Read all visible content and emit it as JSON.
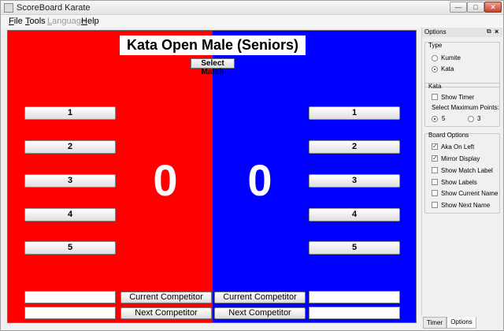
{
  "window": {
    "title": "ScoreBoard Karate"
  },
  "menu": [
    {
      "label": "File",
      "mnemonic": "F",
      "rest": "ile",
      "enabled": true
    },
    {
      "label": "Tools",
      "mnemonic": "T",
      "rest": "ools",
      "enabled": true
    },
    {
      "label": "Language",
      "mnemonic": "L",
      "rest": "anguage",
      "enabled": false
    },
    {
      "label": "Help",
      "mnemonic": "H",
      "rest": "elp",
      "enabled": true
    }
  ],
  "board": {
    "match_label": "Kata Open Male (Seniors)",
    "select_match": "Select Match",
    "aka_color": "#ff0000",
    "ao_color": "#0000ff",
    "aka_buttons": [
      "1",
      "2",
      "3",
      "4",
      "5"
    ],
    "ao_buttons": [
      "1",
      "2",
      "3",
      "4",
      "5"
    ],
    "aka_score": "0",
    "ao_score": "0",
    "aka_current_label": "Current Competitor",
    "aka_next_label": "Next Competitor",
    "ao_current_label": "Current Competitor",
    "ao_next_label": "Next Competitor",
    "aka_current_value": "",
    "aka_next_value": "",
    "ao_current_value": "",
    "ao_next_value": ""
  },
  "options": {
    "title": "Options",
    "type_group": "Type",
    "kumite": "Kumite",
    "kata": "Kata",
    "type_selected": "Kata",
    "kata_group": "Kata",
    "show_timer": "Show Timer",
    "show_timer_checked": false,
    "max_points_label": "Select Maximum Points:",
    "points_options": [
      "5",
      "3"
    ],
    "points_selected": "5",
    "board_group": "Board Options",
    "board_options": [
      {
        "label": "Aka On Left",
        "checked": true
      },
      {
        "label": "Mirror Display",
        "checked": true
      },
      {
        "label": "Show Match Label",
        "checked": false
      },
      {
        "label": "Show Labels",
        "checked": false
      },
      {
        "label": "Show Current Name",
        "checked": false
      },
      {
        "label": "Show Next Name",
        "checked": false
      }
    ]
  },
  "tabs": [
    "Timer",
    "Options"
  ],
  "active_tab": "Options"
}
